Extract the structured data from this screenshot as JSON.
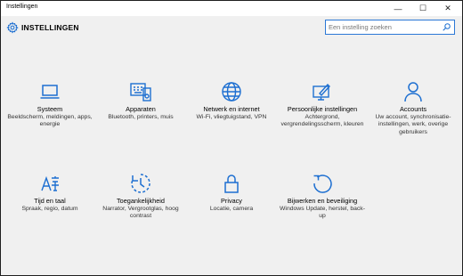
{
  "window": {
    "title": "Instellingen",
    "controls": [
      "—",
      "☐",
      "✕"
    ]
  },
  "header": {
    "title": "INSTELLINGEN",
    "search_placeholder": "Een instelling zoeken"
  },
  "accent": "#1d6fd1",
  "tiles": [
    {
      "icon": "laptop-icon",
      "name": "Systeem",
      "desc": "Beeldscherm, meldingen, apps, energie"
    },
    {
      "icon": "devices-icon",
      "name": "Apparaten",
      "desc": "Bluetooth, printers, muis"
    },
    {
      "icon": "globe-icon",
      "name": "Netwerk en internet",
      "desc": "Wi-Fi, vliegtuigstand, VPN"
    },
    {
      "icon": "paint-screen-icon",
      "name": "Persoonlijke instellingen",
      "desc": "Achtergrond, vergrendelingsscherm, kleuren"
    },
    {
      "icon": "person-icon",
      "name": "Accounts",
      "desc": "Uw account, synchronisatie-instellingen, werk, overige gebruikers"
    },
    {
      "icon": "language-icon",
      "name": "Tijd en taal",
      "desc": "Spraak, regio, datum"
    },
    {
      "icon": "ease-of-access-icon",
      "name": "Toegankelijkheid",
      "desc": "Narrator, Vergrootglas, hoog contrast"
    },
    {
      "icon": "lock-icon",
      "name": "Privacy",
      "desc": "Locatie, camera"
    },
    {
      "icon": "update-icon",
      "name": "Bijwerken en beveiliging",
      "desc": "Windows Update, herstel, back-up"
    }
  ]
}
